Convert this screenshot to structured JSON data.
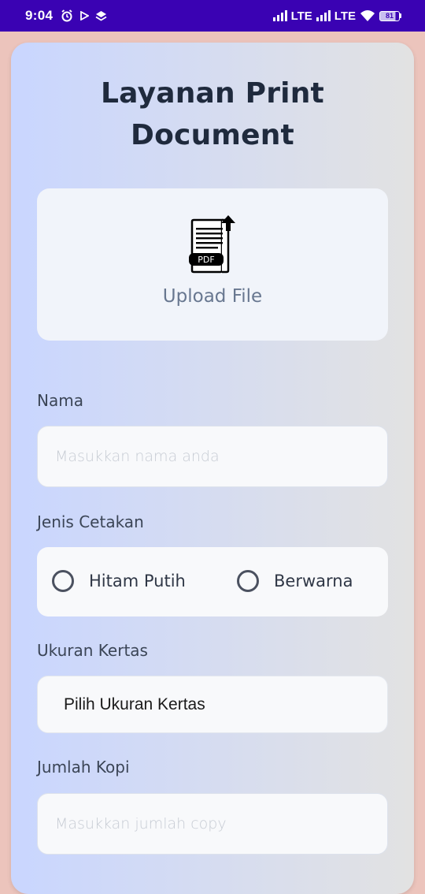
{
  "status_bar": {
    "time": "9:04",
    "network_1": "LTE",
    "network_2": "LTE",
    "battery": "81"
  },
  "page": {
    "title_line1": "Layanan Print",
    "title_line2": "Document"
  },
  "upload": {
    "icon_text": "PDF",
    "label": "Upload File"
  },
  "form": {
    "name_label": "Nama",
    "name_placeholder": "Masukkan nama anda",
    "print_type_label": "Jenis Cetakan",
    "print_type_options": [
      "Hitam Putih",
      "Berwarna"
    ],
    "paper_size_label": "Ukuran Kertas",
    "paper_size_value": "Pilih Ukuran Kertas",
    "copies_label": "Jumlah Kopi",
    "copies_placeholder": "Masukkan jumlah copy"
  },
  "colors": {
    "status_bar_bg": "#3a02b3",
    "page_bg": "#ecc4bc",
    "card_gradient_start": "#c9d6ff",
    "card_gradient_end": "#e2e2e2",
    "title_color": "#1f2a3d"
  }
}
